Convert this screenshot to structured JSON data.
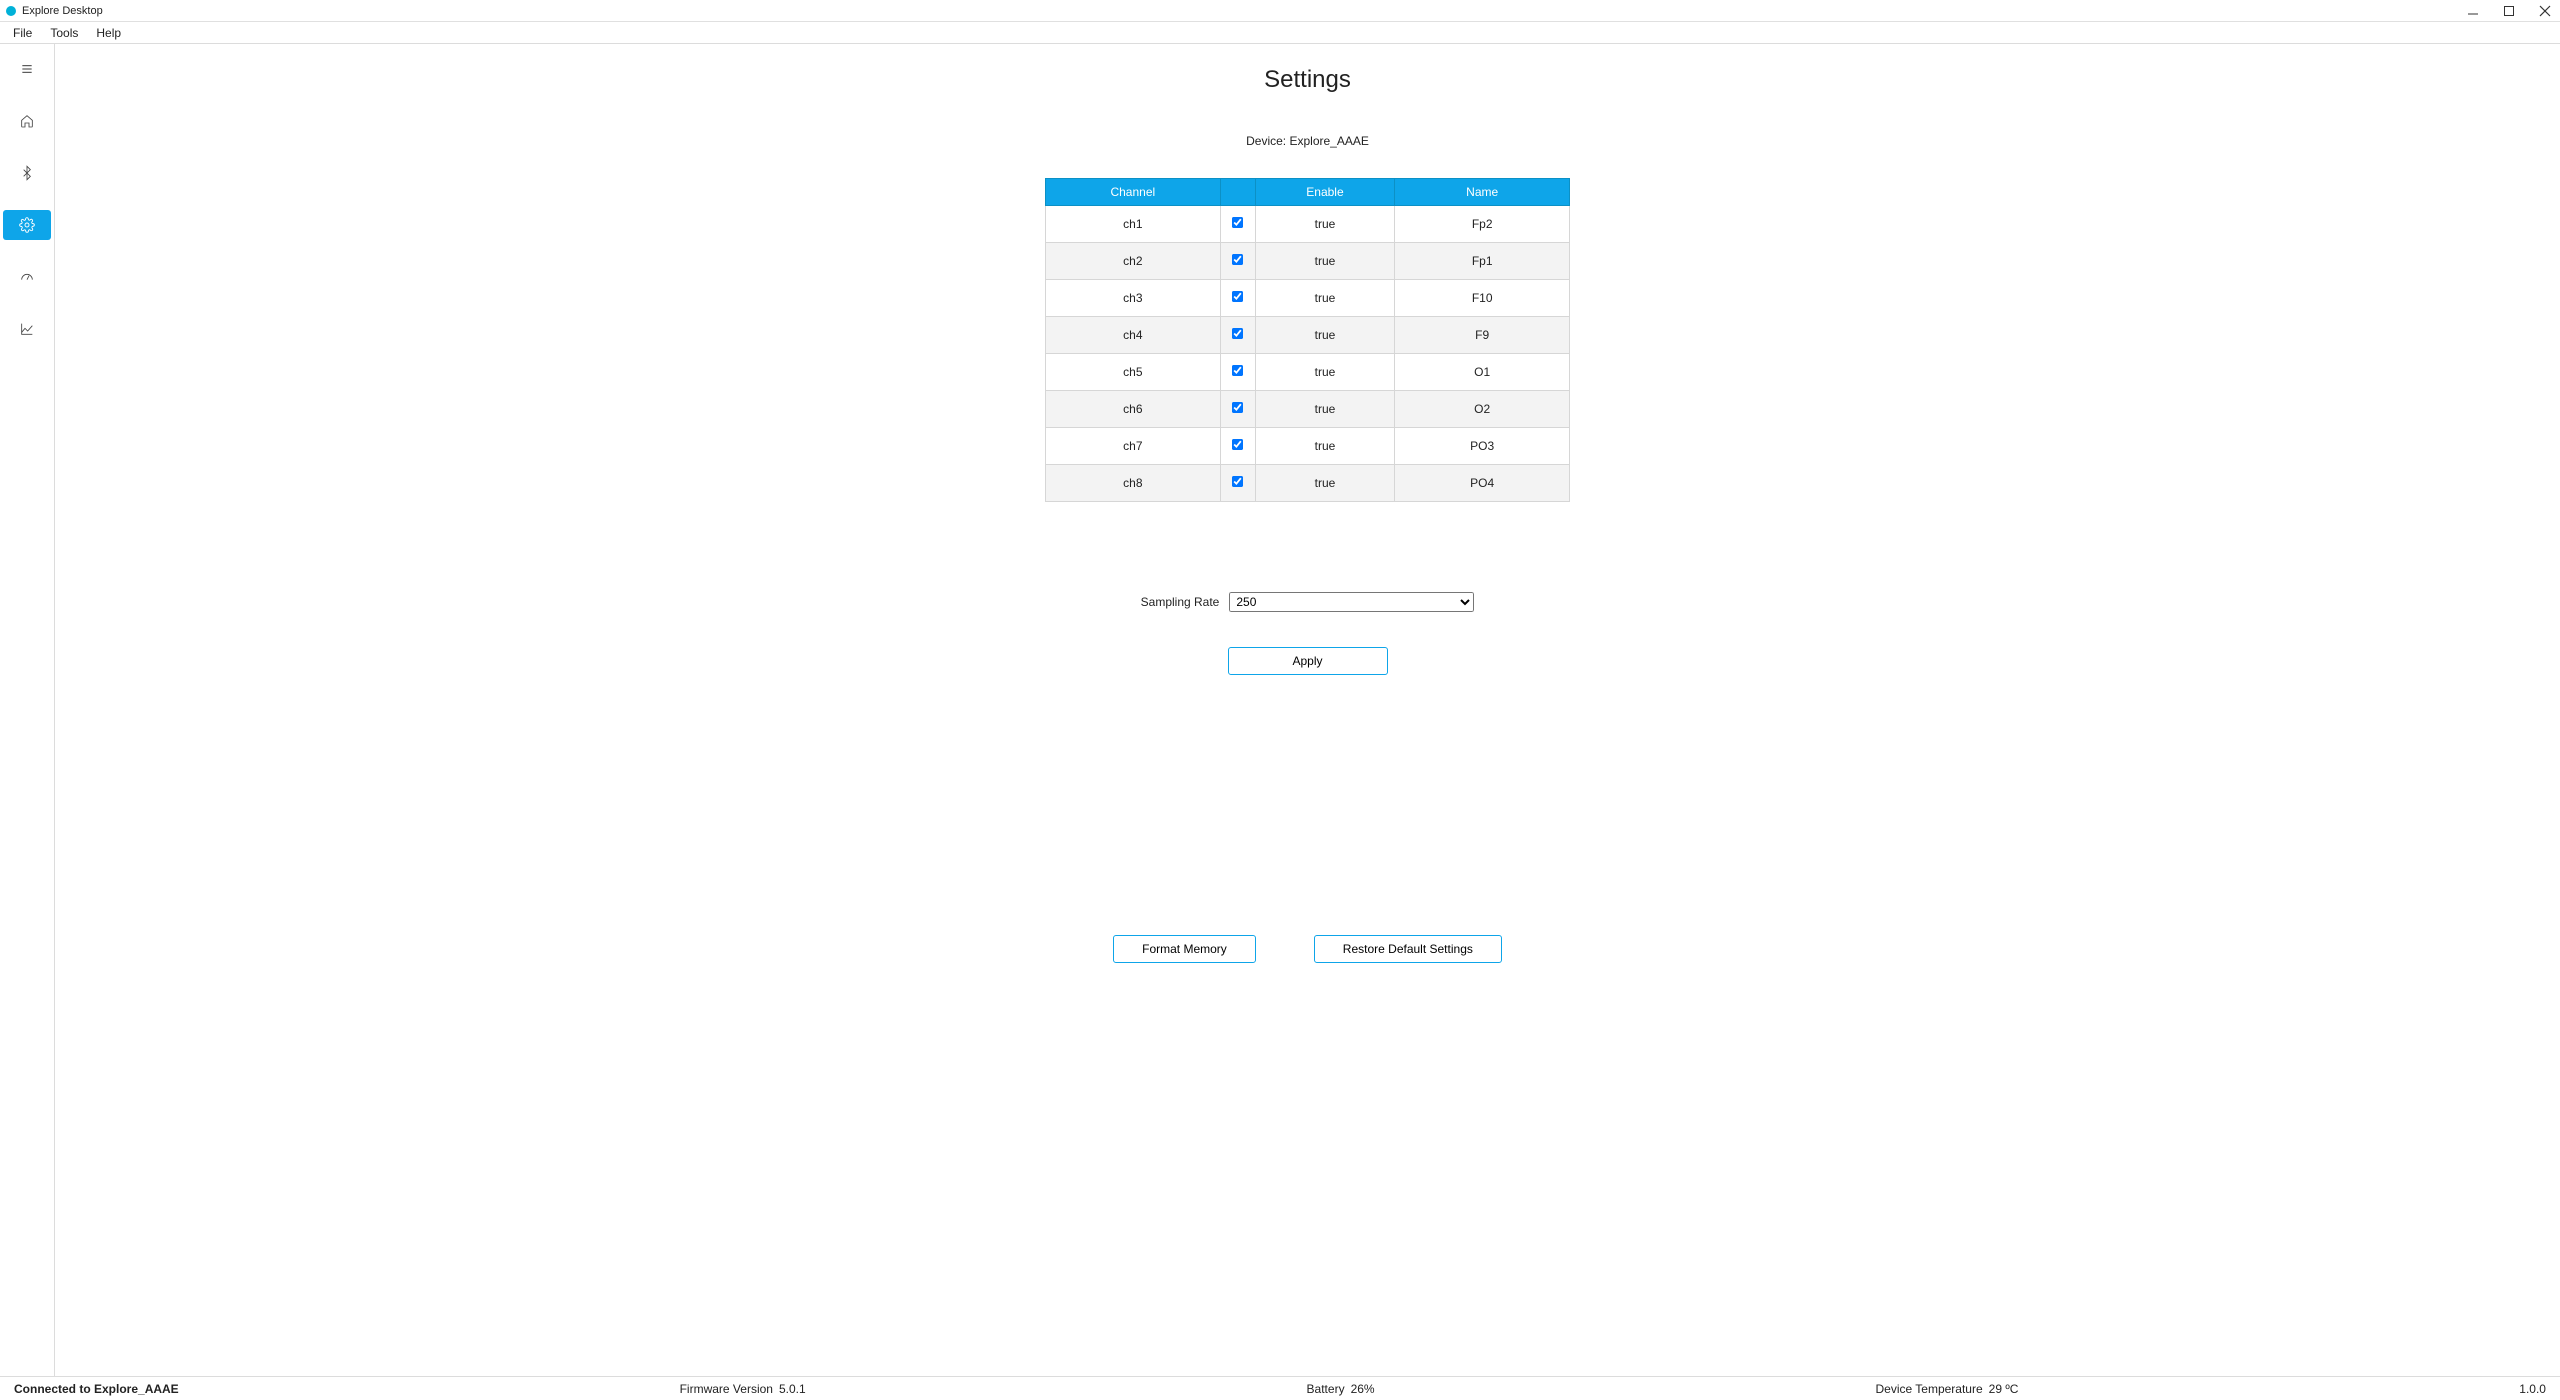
{
  "window": {
    "title": "Explore Desktop"
  },
  "menu": {
    "file": "File",
    "tools": "Tools",
    "help": "Help"
  },
  "sidebar_icons": {
    "menu": "menu-icon",
    "home": "home-icon",
    "bluetooth": "bluetooth-icon",
    "settings": "gear-icon",
    "impedance": "gauge-icon",
    "chart": "chart-icon"
  },
  "main": {
    "title": "Settings",
    "device_label_prefix": "Device: ",
    "device_name": "Explore_AAAE",
    "table": {
      "headers": {
        "channel": "Channel",
        "enable": "Enable",
        "name": "Name"
      },
      "rows": [
        {
          "channel": "ch1",
          "checked": true,
          "enable": "true",
          "name": "Fp2"
        },
        {
          "channel": "ch2",
          "checked": true,
          "enable": "true",
          "name": "Fp1"
        },
        {
          "channel": "ch3",
          "checked": true,
          "enable": "true",
          "name": "F10"
        },
        {
          "channel": "ch4",
          "checked": true,
          "enable": "true",
          "name": "F9"
        },
        {
          "channel": "ch5",
          "checked": true,
          "enable": "true",
          "name": "O1"
        },
        {
          "channel": "ch6",
          "checked": true,
          "enable": "true",
          "name": "O2"
        },
        {
          "channel": "ch7",
          "checked": true,
          "enable": "true",
          "name": "PO3"
        },
        {
          "channel": "ch8",
          "checked": true,
          "enable": "true",
          "name": "PO4"
        }
      ]
    },
    "sampling_label": "Sampling Rate",
    "sampling_value": "250",
    "apply_label": "Apply",
    "format_label": "Format Memory",
    "restore_label": "Restore Default Settings"
  },
  "footer": {
    "connection": "Connected to Explore_AAAE",
    "firmware_label": "Firmware Version",
    "firmware_value": "5.0.1",
    "battery_label": "Battery",
    "battery_value": "26%",
    "temp_label": "Device Temperature",
    "temp_value": "29 ºC",
    "app_version": "1.0.0"
  }
}
